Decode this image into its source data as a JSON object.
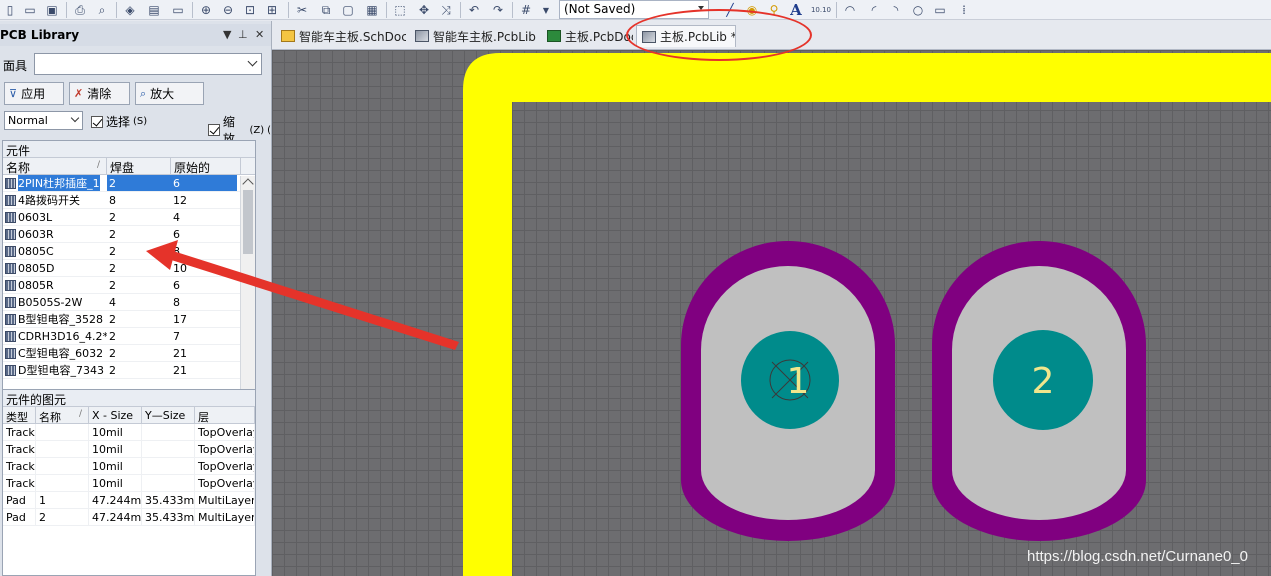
{
  "toolbar": {
    "combo_value": "(Not Saved)",
    "text_tool_glyph": "A",
    "grid_snap_label": "10.10"
  },
  "panel": {
    "title": "PCB Library",
    "mask_label": "面具",
    "mask_value": "",
    "apply_label": "应用",
    "clear_label": "清除",
    "zoom_label": "放大",
    "mode_value": "Normal",
    "select_label": "选择",
    "select_key": "(S)",
    "zoom_check_label": "缩放",
    "zoom_check_key": "(Z)",
    "partial_key": "("
  },
  "components": {
    "section_title": "元件",
    "headers": [
      "名称",
      "焊盘",
      "原始的"
    ],
    "rows": [
      {
        "name": "2PIN杜邦插座_1",
        "pads": "2",
        "prims": "6"
      },
      {
        "name": "4路拨码开关",
        "pads": "8",
        "prims": "12"
      },
      {
        "name": "0603L",
        "pads": "2",
        "prims": "4"
      },
      {
        "name": "0603R",
        "pads": "2",
        "prims": "6"
      },
      {
        "name": "0805C",
        "pads": "2",
        "prims": "8"
      },
      {
        "name": "0805D",
        "pads": "2",
        "prims": "10"
      },
      {
        "name": "0805R",
        "pads": "2",
        "prims": "6"
      },
      {
        "name": "B0505S-2W",
        "pads": "4",
        "prims": "8"
      },
      {
        "name": "B型钽电容_3528",
        "pads": "2",
        "prims": "17"
      },
      {
        "name": "CDRH3D16_4.2*1",
        "pads": "2",
        "prims": "7"
      },
      {
        "name": "C型钽电容_6032",
        "pads": "2",
        "prims": "21"
      },
      {
        "name": "D型钽电容_7343",
        "pads": "2",
        "prims": "21"
      }
    ]
  },
  "primitives": {
    "section_title": "元件的图元",
    "headers": [
      "类型",
      "名称",
      "X - Size",
      "Y—Size",
      "层"
    ],
    "rows": [
      {
        "type": "Track",
        "name": "",
        "x": "10mil",
        "y": "",
        "layer": "TopOverlay"
      },
      {
        "type": "Track",
        "name": "",
        "x": "10mil",
        "y": "",
        "layer": "TopOverlay"
      },
      {
        "type": "Track",
        "name": "",
        "x": "10mil",
        "y": "",
        "layer": "TopOverlay"
      },
      {
        "type": "Track",
        "name": "",
        "x": "10mil",
        "y": "",
        "layer": "TopOverlay"
      },
      {
        "type": "Pad",
        "name": "1",
        "x": "47.244mil",
        "y": "35.433mil",
        "layer": "MultiLayer"
      },
      {
        "type": "Pad",
        "name": "2",
        "x": "47.244mil",
        "y": "35.433mil",
        "layer": "MultiLayer"
      }
    ]
  },
  "tabs": [
    {
      "label": "智能车主板.SchDoc",
      "icon": "sch-icon"
    },
    {
      "label": "智能车主板.PcbLib",
      "icon": "pcblib-icon"
    },
    {
      "label": "主板.PcbDoc",
      "icon": "pcbdoc-icon"
    },
    {
      "label": "主板.PcbLib *",
      "icon": "pcblib-icon"
    }
  ],
  "canvas": {
    "pad1_label": "1",
    "pad2_label": "2",
    "colors": {
      "overlay": "#ffff00",
      "pad_ring": "#800080",
      "pad_copper": "#c0c0c0",
      "drill": "#008b8b",
      "grid_bg": "#6d6d70",
      "annotation": "#e5332a"
    }
  },
  "watermark": "https://blog.csdn.net/Curnane0_0"
}
